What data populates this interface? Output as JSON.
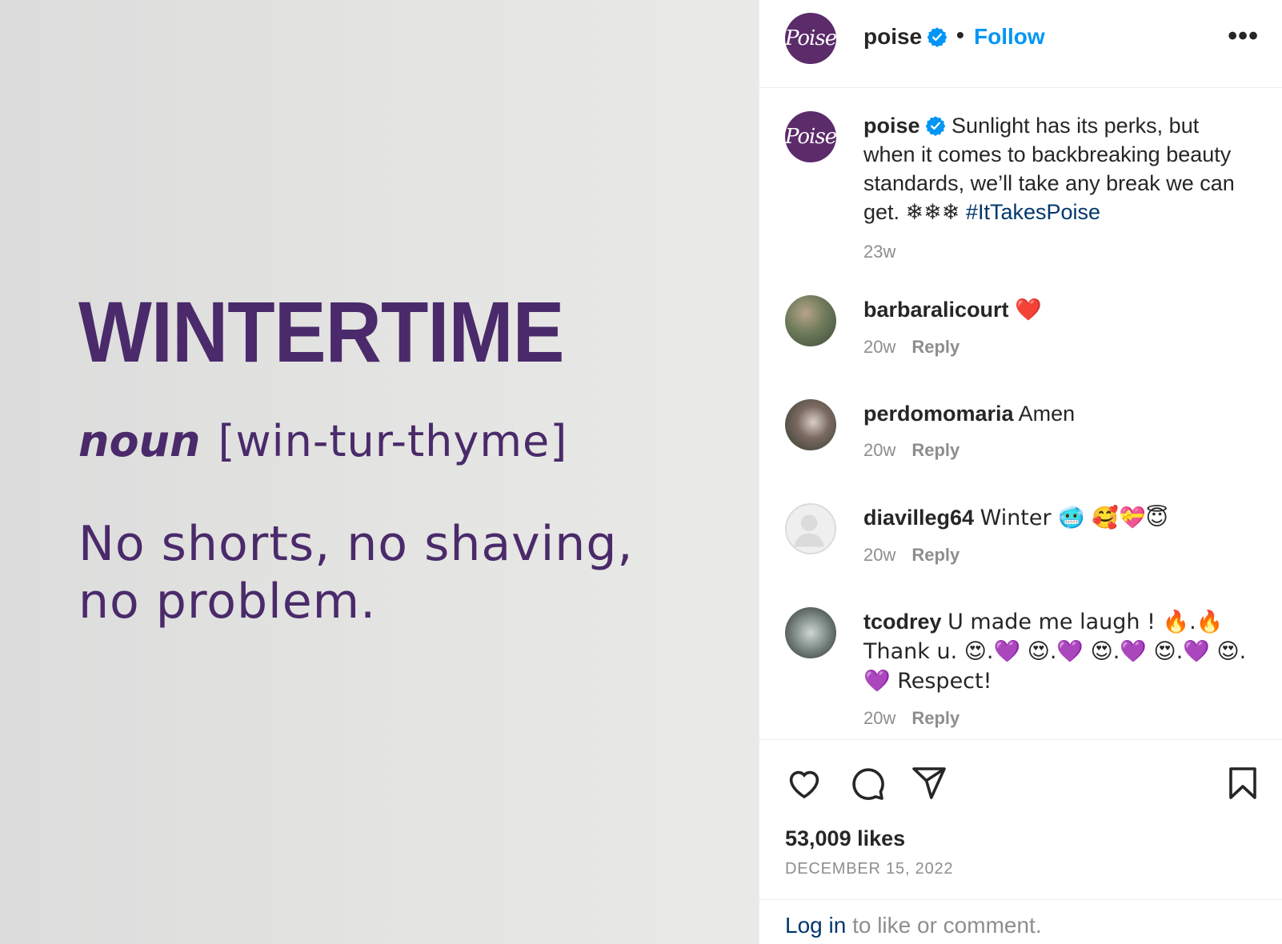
{
  "media": {
    "title": "WINTERTIME",
    "part_of_speech": "noun",
    "pronunciation": "[win-tur-thyme]",
    "tagline": "No shorts, no shaving, no problem."
  },
  "header": {
    "avatar_text": "Poise",
    "username": "poise",
    "separator": "•",
    "follow_label": "Follow",
    "more_label": "•••"
  },
  "caption": {
    "avatar_text": "Poise",
    "username": "poise",
    "text": "Sunlight has its perks, but when it comes to backbreaking beauty standards, we’ll take any break we can get. ❄❄❄",
    "hashtag": "#ItTakesPoise",
    "time": "23w"
  },
  "comments": [
    {
      "username": "barbaralicourt",
      "text": "❤️",
      "time": "20w",
      "reply_label": "Reply"
    },
    {
      "username": "perdomomaria",
      "text": "Amen",
      "time": "20w",
      "reply_label": "Reply"
    },
    {
      "username": "diavilleg64",
      "text": "Winter 🥶 🥰💝😇",
      "time": "20w",
      "reply_label": "Reply"
    },
    {
      "username": "tcodrey",
      "text": "U made me laugh ! 🔥.🔥 Thank u. 😍.💜 😍.💜 😍.💜 😍.💜 😍.💜 Respect!",
      "time": "20w",
      "reply_label": "Reply"
    }
  ],
  "stats": {
    "likes": "53,009 likes",
    "date": "DECEMBER 15, 2022"
  },
  "login_bar": {
    "login_label": "Log in",
    "rest": " to like or comment."
  },
  "colors": {
    "brand_purple": "#4a2a6a",
    "follow_blue": "#0095f6",
    "link_navy": "#00376b"
  }
}
